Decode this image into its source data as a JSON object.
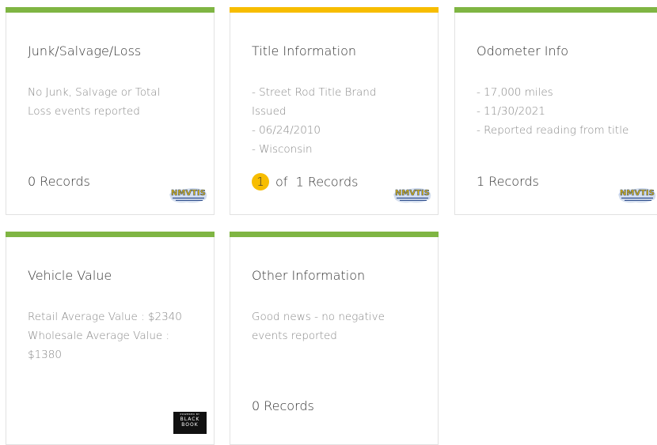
{
  "colors": {
    "green": "#7fb543",
    "yellow": "#f7bd00"
  },
  "cards": [
    {
      "title": "Junk/Salvage/Loss",
      "lines": [
        "No Junk, Salvage or Total",
        "Loss events reported"
      ],
      "records": "0 Records",
      "logo": "nmvtis-logo"
    },
    {
      "title": "Title Information",
      "lines": [
        "- Street Rod Title Brand",
        "Issued",
        "- 06/24/2010",
        "- Wisconsin"
      ],
      "badge": "1",
      "records": "of  1 Records",
      "logo": "nmvtis-logo"
    },
    {
      "title": "Odometer Info",
      "lines": [
        "- 17,000 miles",
        "- 11/30/2021",
        "- Reported reading from title"
      ],
      "records": "1 Records",
      "logo": "nmvtis-logo"
    },
    {
      "title": "Vehicle Value",
      "lines": [
        "Retail Average Value : $2340",
        "Wholesale Average Value :",
        "$1380"
      ],
      "logo": "black-book-logo",
      "logo_text": {
        "small": "POWERED BY",
        "line1": "BLACK",
        "line2": "BOOK"
      }
    },
    {
      "title": "Other Information",
      "lines": [
        "Good news - no negative",
        "events reported"
      ],
      "records": "0 Records"
    }
  ]
}
